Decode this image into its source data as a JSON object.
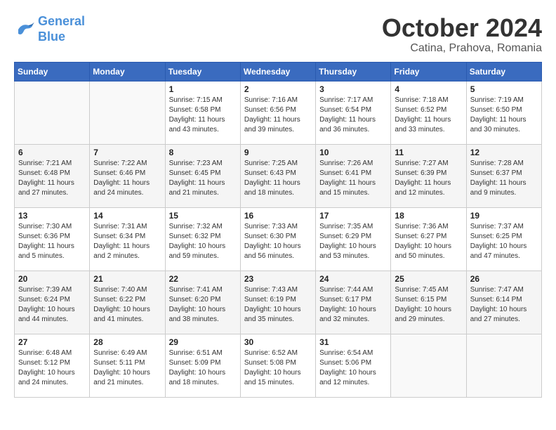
{
  "header": {
    "logo_line1": "General",
    "logo_line2": "Blue",
    "month": "October 2024",
    "location": "Catina, Prahova, Romania"
  },
  "weekdays": [
    "Sunday",
    "Monday",
    "Tuesday",
    "Wednesday",
    "Thursday",
    "Friday",
    "Saturday"
  ],
  "weeks": [
    [
      {
        "day": "",
        "sunrise": "",
        "sunset": "",
        "daylight": ""
      },
      {
        "day": "",
        "sunrise": "",
        "sunset": "",
        "daylight": ""
      },
      {
        "day": "1",
        "sunrise": "Sunrise: 7:15 AM",
        "sunset": "Sunset: 6:58 PM",
        "daylight": "Daylight: 11 hours and 43 minutes."
      },
      {
        "day": "2",
        "sunrise": "Sunrise: 7:16 AM",
        "sunset": "Sunset: 6:56 PM",
        "daylight": "Daylight: 11 hours and 39 minutes."
      },
      {
        "day": "3",
        "sunrise": "Sunrise: 7:17 AM",
        "sunset": "Sunset: 6:54 PM",
        "daylight": "Daylight: 11 hours and 36 minutes."
      },
      {
        "day": "4",
        "sunrise": "Sunrise: 7:18 AM",
        "sunset": "Sunset: 6:52 PM",
        "daylight": "Daylight: 11 hours and 33 minutes."
      },
      {
        "day": "5",
        "sunrise": "Sunrise: 7:19 AM",
        "sunset": "Sunset: 6:50 PM",
        "daylight": "Daylight: 11 hours and 30 minutes."
      }
    ],
    [
      {
        "day": "6",
        "sunrise": "Sunrise: 7:21 AM",
        "sunset": "Sunset: 6:48 PM",
        "daylight": "Daylight: 11 hours and 27 minutes."
      },
      {
        "day": "7",
        "sunrise": "Sunrise: 7:22 AM",
        "sunset": "Sunset: 6:46 PM",
        "daylight": "Daylight: 11 hours and 24 minutes."
      },
      {
        "day": "8",
        "sunrise": "Sunrise: 7:23 AM",
        "sunset": "Sunset: 6:45 PM",
        "daylight": "Daylight: 11 hours and 21 minutes."
      },
      {
        "day": "9",
        "sunrise": "Sunrise: 7:25 AM",
        "sunset": "Sunset: 6:43 PM",
        "daylight": "Daylight: 11 hours and 18 minutes."
      },
      {
        "day": "10",
        "sunrise": "Sunrise: 7:26 AM",
        "sunset": "Sunset: 6:41 PM",
        "daylight": "Daylight: 11 hours and 15 minutes."
      },
      {
        "day": "11",
        "sunrise": "Sunrise: 7:27 AM",
        "sunset": "Sunset: 6:39 PM",
        "daylight": "Daylight: 11 hours and 12 minutes."
      },
      {
        "day": "12",
        "sunrise": "Sunrise: 7:28 AM",
        "sunset": "Sunset: 6:37 PM",
        "daylight": "Daylight: 11 hours and 9 minutes."
      }
    ],
    [
      {
        "day": "13",
        "sunrise": "Sunrise: 7:30 AM",
        "sunset": "Sunset: 6:36 PM",
        "daylight": "Daylight: 11 hours and 5 minutes."
      },
      {
        "day": "14",
        "sunrise": "Sunrise: 7:31 AM",
        "sunset": "Sunset: 6:34 PM",
        "daylight": "Daylight: 11 hours and 2 minutes."
      },
      {
        "day": "15",
        "sunrise": "Sunrise: 7:32 AM",
        "sunset": "Sunset: 6:32 PM",
        "daylight": "Daylight: 10 hours and 59 minutes."
      },
      {
        "day": "16",
        "sunrise": "Sunrise: 7:33 AM",
        "sunset": "Sunset: 6:30 PM",
        "daylight": "Daylight: 10 hours and 56 minutes."
      },
      {
        "day": "17",
        "sunrise": "Sunrise: 7:35 AM",
        "sunset": "Sunset: 6:29 PM",
        "daylight": "Daylight: 10 hours and 53 minutes."
      },
      {
        "day": "18",
        "sunrise": "Sunrise: 7:36 AM",
        "sunset": "Sunset: 6:27 PM",
        "daylight": "Daylight: 10 hours and 50 minutes."
      },
      {
        "day": "19",
        "sunrise": "Sunrise: 7:37 AM",
        "sunset": "Sunset: 6:25 PM",
        "daylight": "Daylight: 10 hours and 47 minutes."
      }
    ],
    [
      {
        "day": "20",
        "sunrise": "Sunrise: 7:39 AM",
        "sunset": "Sunset: 6:24 PM",
        "daylight": "Daylight: 10 hours and 44 minutes."
      },
      {
        "day": "21",
        "sunrise": "Sunrise: 7:40 AM",
        "sunset": "Sunset: 6:22 PM",
        "daylight": "Daylight: 10 hours and 41 minutes."
      },
      {
        "day": "22",
        "sunrise": "Sunrise: 7:41 AM",
        "sunset": "Sunset: 6:20 PM",
        "daylight": "Daylight: 10 hours and 38 minutes."
      },
      {
        "day": "23",
        "sunrise": "Sunrise: 7:43 AM",
        "sunset": "Sunset: 6:19 PM",
        "daylight": "Daylight: 10 hours and 35 minutes."
      },
      {
        "day": "24",
        "sunrise": "Sunrise: 7:44 AM",
        "sunset": "Sunset: 6:17 PM",
        "daylight": "Daylight: 10 hours and 32 minutes."
      },
      {
        "day": "25",
        "sunrise": "Sunrise: 7:45 AM",
        "sunset": "Sunset: 6:15 PM",
        "daylight": "Daylight: 10 hours and 29 minutes."
      },
      {
        "day": "26",
        "sunrise": "Sunrise: 7:47 AM",
        "sunset": "Sunset: 6:14 PM",
        "daylight": "Daylight: 10 hours and 27 minutes."
      }
    ],
    [
      {
        "day": "27",
        "sunrise": "Sunrise: 6:48 AM",
        "sunset": "Sunset: 5:12 PM",
        "daylight": "Daylight: 10 hours and 24 minutes."
      },
      {
        "day": "28",
        "sunrise": "Sunrise: 6:49 AM",
        "sunset": "Sunset: 5:11 PM",
        "daylight": "Daylight: 10 hours and 21 minutes."
      },
      {
        "day": "29",
        "sunrise": "Sunrise: 6:51 AM",
        "sunset": "Sunset: 5:09 PM",
        "daylight": "Daylight: 10 hours and 18 minutes."
      },
      {
        "day": "30",
        "sunrise": "Sunrise: 6:52 AM",
        "sunset": "Sunset: 5:08 PM",
        "daylight": "Daylight: 10 hours and 15 minutes."
      },
      {
        "day": "31",
        "sunrise": "Sunrise: 6:54 AM",
        "sunset": "Sunset: 5:06 PM",
        "daylight": "Daylight: 10 hours and 12 minutes."
      },
      {
        "day": "",
        "sunrise": "",
        "sunset": "",
        "daylight": ""
      },
      {
        "day": "",
        "sunrise": "",
        "sunset": "",
        "daylight": ""
      }
    ]
  ]
}
